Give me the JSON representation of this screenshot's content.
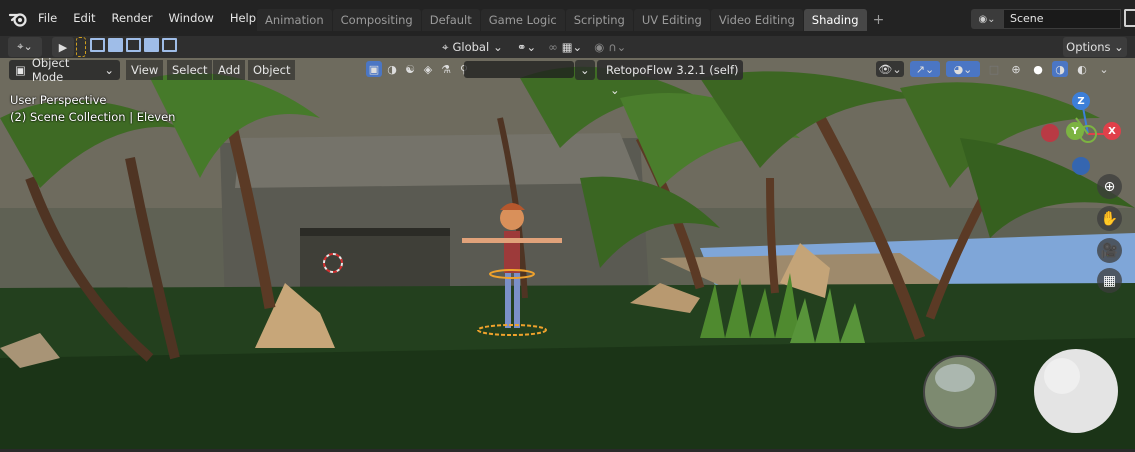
{
  "menu": {
    "items": [
      "File",
      "Edit",
      "Render",
      "Window",
      "Help"
    ]
  },
  "workspace_tabs": [
    {
      "label": "Animation",
      "active": false
    },
    {
      "label": "Compositing",
      "active": false
    },
    {
      "label": "Default",
      "active": false
    },
    {
      "label": "Game Logic",
      "active": false
    },
    {
      "label": "Scripting",
      "active": false
    },
    {
      "label": "UV Editing",
      "active": false
    },
    {
      "label": "Video Editing",
      "active": false
    },
    {
      "label": "Shading",
      "active": true
    }
  ],
  "tab_add_label": "+",
  "scene": {
    "name": "Scene"
  },
  "tool_header": {
    "orientation_label": "Global",
    "options_label": "Options"
  },
  "viewport_header": {
    "mode_label": "Object Mode",
    "menus": [
      "View",
      "Select",
      "Add",
      "Object"
    ],
    "addon_dropdown": "RetopoFlow 3.2.1 (self)"
  },
  "viewport_overlay": {
    "perspective": "User Perspective",
    "collection_info": "(2) Scene Collection | Eleven"
  },
  "gizmo": {
    "z_label": "Z",
    "y_label": "Y",
    "x_label": "X",
    "colors": {
      "x": "#e0404a",
      "y": "#7cb342",
      "z": "#3d7fd8"
    }
  },
  "icons": [
    "blender-logo-icon",
    "zoom-icon",
    "pan-hand-icon",
    "camera-icon",
    "grid-icon"
  ],
  "colors": {
    "active_tab": "#474747",
    "accent_select": "#9fbde8"
  }
}
